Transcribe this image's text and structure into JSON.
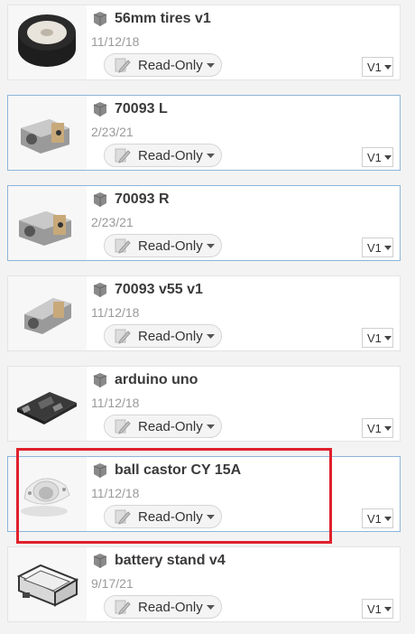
{
  "items": [
    {
      "name": "56mm tires v1",
      "date": "11/12/18",
      "access": "Read-Only",
      "version": "V1",
      "thumbnail": "tire-thumbnail"
    },
    {
      "name": "70093 L",
      "date": "2/23/21",
      "access": "Read-Only",
      "version": "V1",
      "thumbnail": "gearbox-motor-thumbnail"
    },
    {
      "name": "70093 R",
      "date": "2/23/21",
      "access": "Read-Only",
      "version": "V1",
      "thumbnail": "gearbox-motor-thumbnail"
    },
    {
      "name": "70093 v55 v1",
      "date": "11/12/18",
      "access": "Read-Only",
      "version": "V1",
      "thumbnail": "gearbox-motor-thumbnail"
    },
    {
      "name": "arduino uno",
      "date": "11/12/18",
      "access": "Read-Only",
      "version": "V1",
      "thumbnail": "circuit-board-thumbnail"
    },
    {
      "name": "ball castor CY 15A",
      "date": "11/12/18",
      "access": "Read-Only",
      "version": "V1",
      "thumbnail": "ball-castor-thumbnail"
    },
    {
      "name": "battery stand v4",
      "date": "9/17/21",
      "access": "Read-Only",
      "version": "V1",
      "thumbnail": "battery-holder-thumbnail"
    }
  ],
  "colors": {
    "highlight": "#e0202c",
    "selected_border": "#8db5da"
  }
}
